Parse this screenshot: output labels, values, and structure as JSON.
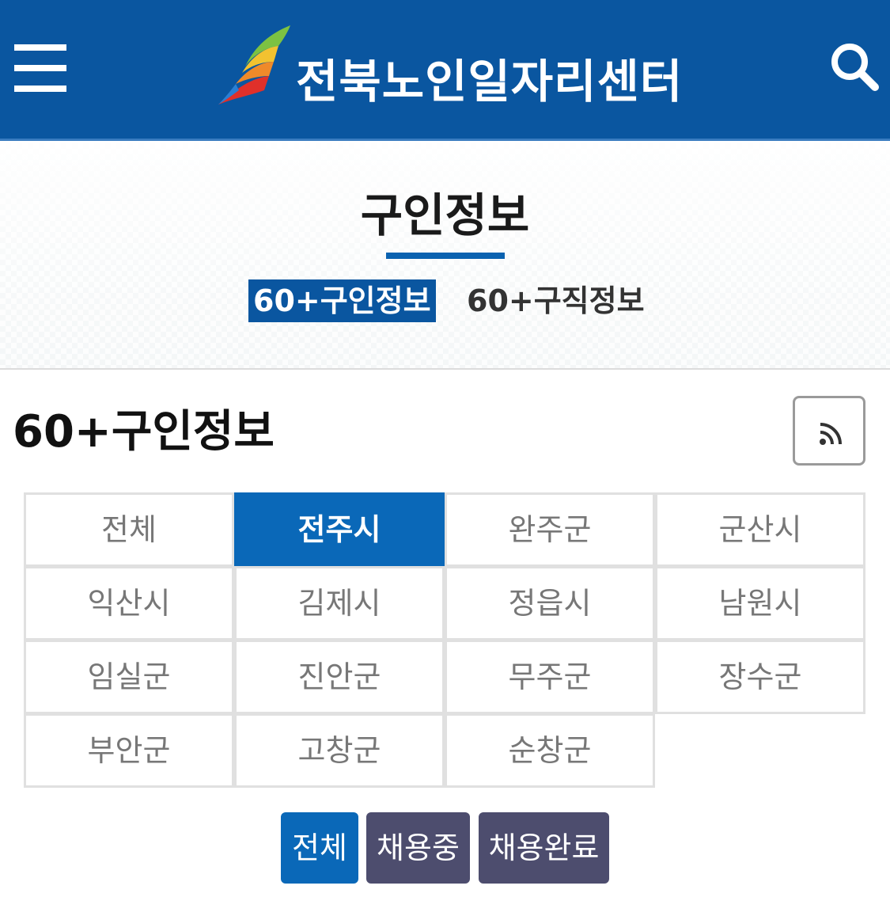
{
  "header": {
    "logo_text": "전북노인일자리센터",
    "menu_icon": "hamburger-icon",
    "search_icon": "search-icon",
    "color": "#0a56a0"
  },
  "hero": {
    "title": "구인정보",
    "tabs": [
      {
        "label": "60+구인정보",
        "active": true
      },
      {
        "label": "60+구직정보",
        "active": false
      }
    ]
  },
  "section": {
    "title": "60+구인정보",
    "rss_icon": "rss-icon"
  },
  "regions": [
    {
      "label": "전체",
      "active": false
    },
    {
      "label": "전주시",
      "active": true
    },
    {
      "label": "완주군",
      "active": false
    },
    {
      "label": "군산시",
      "active": false
    },
    {
      "label": "익산시",
      "active": false
    },
    {
      "label": "김제시",
      "active": false
    },
    {
      "label": "정읍시",
      "active": false
    },
    {
      "label": "남원시",
      "active": false
    },
    {
      "label": "임실군",
      "active": false
    },
    {
      "label": "진안군",
      "active": false
    },
    {
      "label": "무주군",
      "active": false
    },
    {
      "label": "장수군",
      "active": false
    },
    {
      "label": "부안군",
      "active": false
    },
    {
      "label": "고창군",
      "active": false
    },
    {
      "label": "순창군",
      "active": false
    }
  ],
  "filters": [
    {
      "label": "전체",
      "active": true
    },
    {
      "label": "채용중",
      "active": false
    },
    {
      "label": "채용완료",
      "active": false
    }
  ],
  "colors": {
    "accent": "#0a68b8",
    "inactive_filter": "#4d4d6e"
  }
}
